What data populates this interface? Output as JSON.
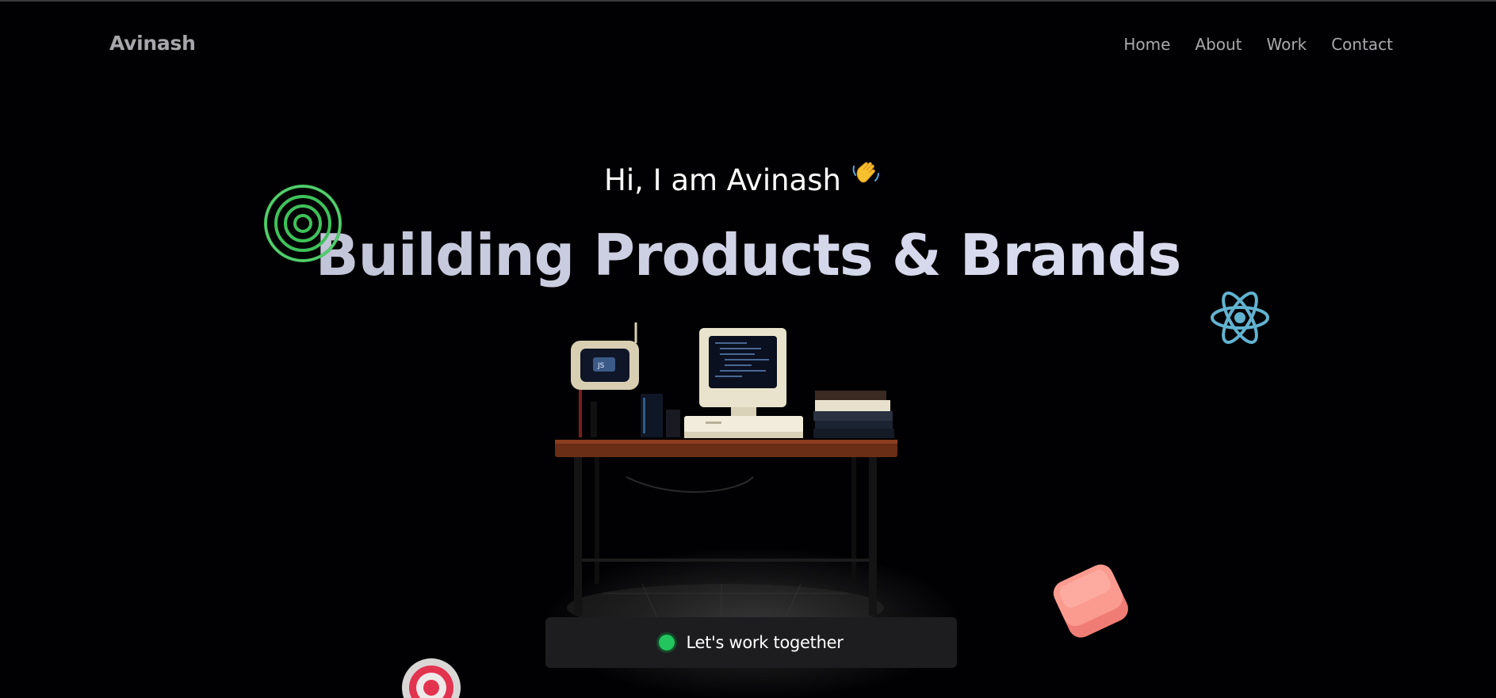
{
  "nav": {
    "logo": "Avinash",
    "links": [
      "Home",
      "About",
      "Work",
      "Contact"
    ]
  },
  "hero": {
    "greeting": "Hi, I am Avinash",
    "headline": "Building Products & Brands"
  },
  "cta": {
    "label": "Let's work together"
  },
  "icons": [
    "waving-hand-icon",
    "concentric-rings-icon",
    "react-atom-icon",
    "rounded-cube-icon",
    "target-icon",
    "desk-workstation-illustration"
  ],
  "colors": {
    "background": "#010103",
    "status_green": "#22c55e",
    "react_blue": "#61b3d0",
    "ring_green": "#3ec25a",
    "cube_pink": "#f68a82",
    "target_red": "#e2334f"
  }
}
